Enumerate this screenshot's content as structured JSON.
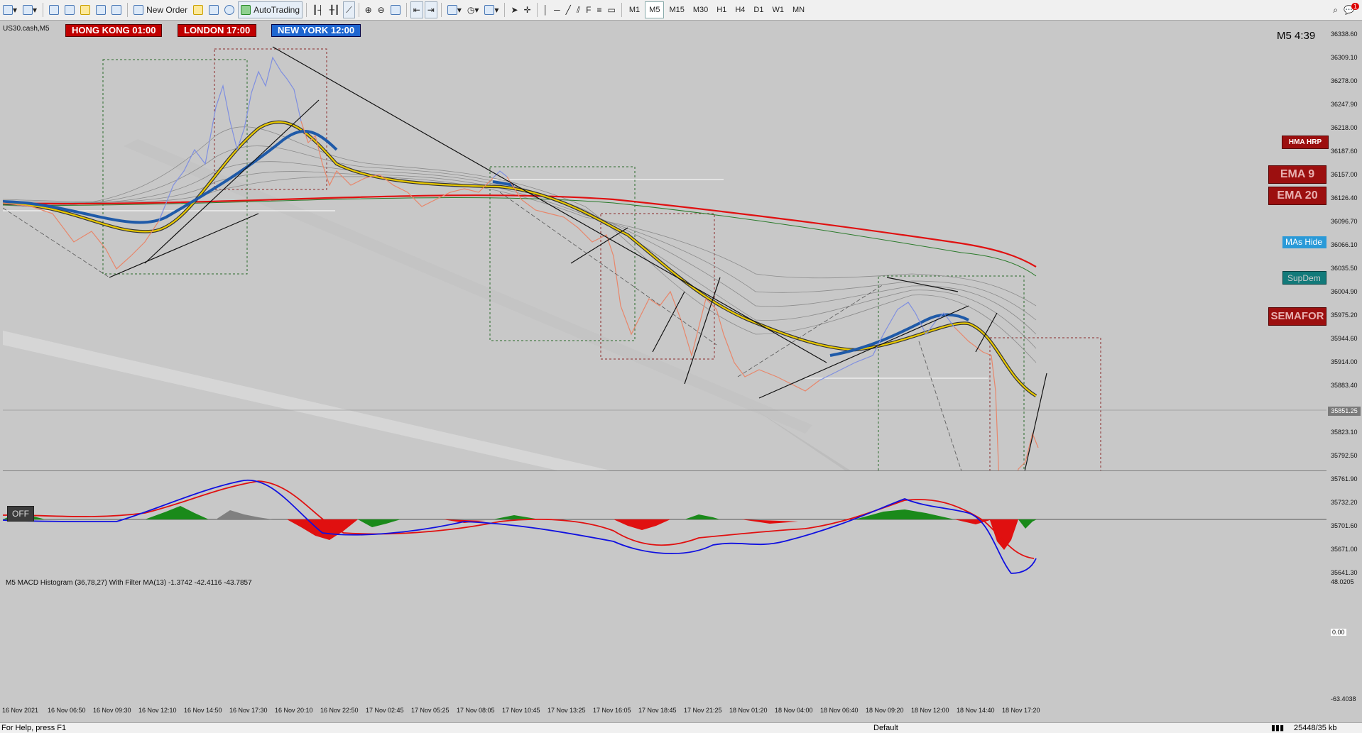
{
  "toolbar": {
    "new_order": "New Order",
    "autotrading": "AutoTrading",
    "timeframes": [
      "M1",
      "M5",
      "M15",
      "M30",
      "H1",
      "H4",
      "D1",
      "W1",
      "MN"
    ],
    "active_timeframe": "M5",
    "notification_count": "1"
  },
  "chart": {
    "symbol": "US30.cash,M5",
    "countdown": "M5 4:39",
    "current_price": "35851.25",
    "sessions": [
      {
        "label": "HONG KONG 01:00",
        "color": "#c00000"
      },
      {
        "label": "LONDON  17:00",
        "color": "#c00000"
      },
      {
        "label": "NEW YORK 12:00",
        "color": "#1e66d0"
      }
    ],
    "panel_buttons": {
      "hma": "HMA HRP",
      "ema9": "EMA 9",
      "ema20": "EMA 20",
      "mas_hide": "MAs Hide",
      "supdem": "SupDem",
      "semafor": "SEMAFOR"
    },
    "off_button": "OFF",
    "price_labels": [
      "36338.60",
      "36309.10",
      "36278.00",
      "36247.90",
      "36218.00",
      "36187.60",
      "36157.00",
      "36126.40",
      "36096.70",
      "36066.10",
      "36035.50",
      "36004.90",
      "35975.20",
      "35944.60",
      "35914.00",
      "35883.40",
      "35851.25",
      "35823.10",
      "35792.50",
      "35761.90",
      "35732.20",
      "35701.60",
      "35671.00",
      "35641.30"
    ],
    "macd_labels": [
      "48.0205",
      "0.00",
      "-63.4038"
    ],
    "macd_title": "M5 MACD Histogram (36,78,27) With Filter MA(13) -1.3742 -42.4116 -43.7857",
    "time_labels": [
      "16 Nov 2021",
      "16 Nov 06:50",
      "16 Nov 09:30",
      "16 Nov 12:10",
      "16 Nov 14:50",
      "16 Nov 17:30",
      "16 Nov 20:10",
      "16 Nov 22:50",
      "17 Nov 02:45",
      "17 Nov 05:25",
      "17 Nov 08:05",
      "17 Nov 10:45",
      "17 Nov 13:25",
      "17 Nov 16:05",
      "17 Nov 18:45",
      "17 Nov 21:25",
      "18 Nov 01:20",
      "18 Nov 04:00",
      "18 Nov 06:40",
      "18 Nov 09:20",
      "18 Nov 12:00",
      "18 Nov 14:40",
      "18 Nov 17:20"
    ]
  },
  "status": {
    "help": "For Help, press F1",
    "profile": "Default",
    "traffic": "25448/35 kb"
  }
}
